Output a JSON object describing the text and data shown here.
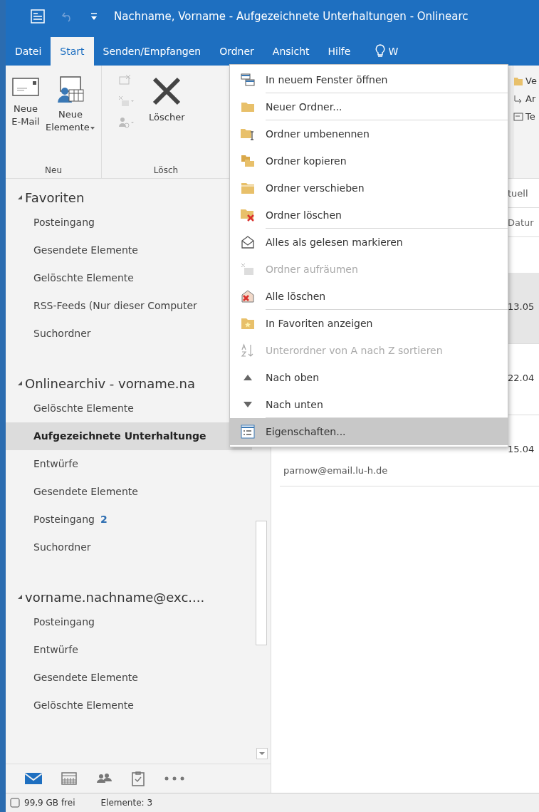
{
  "window": {
    "title": "Nachname, Vorname - Aufgezeichnete Unterhaltungen - Onlinearc"
  },
  "tabs": [
    {
      "label": "Datei",
      "selected": false
    },
    {
      "label": "Start",
      "selected": true
    },
    {
      "label": "Senden/Empfangen",
      "selected": false
    },
    {
      "label": "Ordner",
      "selected": false
    },
    {
      "label": "Ansicht",
      "selected": false
    },
    {
      "label": "Hilfe",
      "selected": false
    }
  ],
  "tell_me": {
    "text": "W"
  },
  "ribbon": {
    "groups": [
      {
        "label": "Neu",
        "buttons": [
          {
            "label": "Neue\nE-Mail",
            "kind": "mail",
            "dropdown": false
          },
          {
            "label": "Neue\nElemente",
            "kind": "items",
            "dropdown": true
          }
        ]
      },
      {
        "label": "Lösch",
        "buttons": [
          {
            "label": "Löscher",
            "kind": "delete",
            "dropdown": false
          }
        ]
      }
    ],
    "right_items": [
      {
        "label": "Ve",
        "kind": "folder"
      },
      {
        "label": "Ar",
        "kind": "arrow"
      },
      {
        "label": "Te",
        "kind": "template"
      }
    ]
  },
  "sidebar": {
    "sections": [
      {
        "title": "Favoriten",
        "expanded": true,
        "items": [
          {
            "label": "Posteingang",
            "selected": false
          },
          {
            "label": "Gesendete Elemente",
            "selected": false
          },
          {
            "label": "Gelöschte Elemente",
            "selected": false
          },
          {
            "label": "RSS-Feeds (Nur dieser Computer",
            "selected": false
          },
          {
            "label": "Suchordner",
            "selected": false
          }
        ]
      },
      {
        "title": "Onlinearchiv - vorname.na",
        "expanded": true,
        "items": [
          {
            "label": "Gelöschte Elemente",
            "selected": false
          },
          {
            "label": "Aufgezeichnete Unterhaltunge",
            "selected": true
          },
          {
            "label": "Entwürfe",
            "selected": false
          },
          {
            "label": "Gesendete Elemente",
            "selected": false
          },
          {
            "label": "Posteingang",
            "count": "2",
            "selected": false
          },
          {
            "label": "Suchordner",
            "selected": false
          }
        ]
      },
      {
        "title": "vorname.nachname@exc....",
        "expanded": true,
        "items": [
          {
            "label": "Posteingang",
            "selected": false
          },
          {
            "label": "Entwürfe",
            "selected": false
          },
          {
            "label": "Gesendete Elemente",
            "selected": false
          },
          {
            "label": "Gelöschte Elemente",
            "selected": false
          }
        ]
      }
    ]
  },
  "nav": [
    {
      "kind": "mail",
      "selected": true
    },
    {
      "kind": "calendar",
      "selected": false
    },
    {
      "kind": "people",
      "selected": false
    },
    {
      "kind": "tasks",
      "selected": false
    },
    {
      "kind": "more",
      "selected": false
    }
  ],
  "message_list": {
    "search": {
      "placeholder": "tuell"
    },
    "column": "Datur",
    "rows": [
      {
        "date": "13.05",
        "selected": true
      },
      {
        "date": "22.04",
        "selected": false
      },
      {
        "date": "15.04",
        "address": "parnow@email.lu-h.de",
        "selected": false
      }
    ]
  },
  "context_menu": [
    {
      "label": "In neuem Fenster öffnen",
      "kind": "window",
      "disabled": false,
      "selected": false,
      "separator_after": true
    },
    {
      "label": "Neuer Ordner...",
      "kind": "folder",
      "disabled": false,
      "selected": false,
      "separator_after": true
    },
    {
      "label": "Ordner umbenennen",
      "kind": "rename",
      "disabled": false,
      "selected": false,
      "separator_after": false
    },
    {
      "label": "Ordner kopieren",
      "kind": "copy",
      "disabled": false,
      "selected": false,
      "separator_after": false
    },
    {
      "label": "Ordner verschieben",
      "kind": "move",
      "disabled": false,
      "selected": false,
      "separator_after": false
    },
    {
      "label": "Ordner löschen",
      "kind": "delete",
      "disabled": false,
      "selected": false,
      "separator_after": true
    },
    {
      "label": "Alles als gelesen markieren",
      "kind": "read",
      "disabled": false,
      "selected": false,
      "separator_after": false
    },
    {
      "label": "Ordner aufräumen",
      "kind": "cleanup",
      "disabled": true,
      "selected": false,
      "separator_after": false
    },
    {
      "label": "Alle löschen",
      "kind": "deleteall",
      "disabled": false,
      "selected": false,
      "separator_after": true
    },
    {
      "label": "In Favoriten anzeigen",
      "kind": "favorite",
      "disabled": false,
      "selected": false,
      "separator_after": false
    },
    {
      "label": "Unterordner von A nach Z sortieren",
      "kind": "sort",
      "disabled": true,
      "selected": false,
      "separator_after": false
    },
    {
      "label": "Nach oben",
      "kind": "up",
      "disabled": false,
      "selected": false,
      "separator_after": false
    },
    {
      "label": "Nach unten",
      "kind": "down",
      "disabled": false,
      "selected": false,
      "separator_after": true
    },
    {
      "label": "Eigenschaften...",
      "kind": "properties",
      "disabled": false,
      "selected": true,
      "separator_after": false
    }
  ],
  "status_bar": {
    "storage": "99,9 GB frei",
    "items": "Elemente: 3"
  }
}
